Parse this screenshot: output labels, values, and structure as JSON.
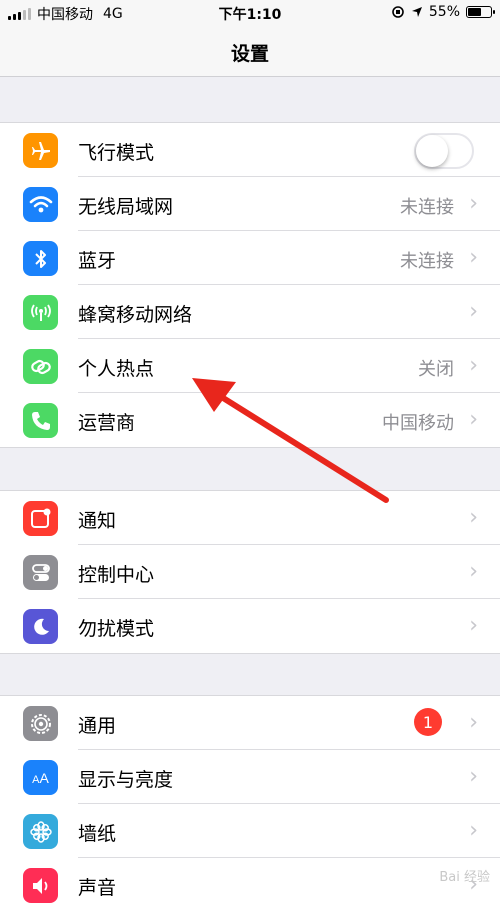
{
  "status_bar": {
    "carrier": "中国移动",
    "network": "4G",
    "time": "下午1:10",
    "battery": "55%"
  },
  "nav": {
    "title": "设置"
  },
  "group1": [
    {
      "label": "飞行模式",
      "color": "#ff9500",
      "icon": "airplane-icon",
      "toggle": "off"
    },
    {
      "label": "无线局域网",
      "value": "未连接",
      "color": "#1a82fb",
      "icon": "wifi-icon"
    },
    {
      "label": "蓝牙",
      "value": "未连接",
      "color": "#1a82fb",
      "icon": "bluetooth-icon"
    },
    {
      "label": "蜂窝移动网络",
      "color": "#4cd964",
      "icon": "cellular-icon"
    },
    {
      "label": "个人热点",
      "value": "关闭",
      "color": "#4cd964",
      "icon": "hotspot-icon"
    },
    {
      "label": "运营商",
      "value": "中国移动",
      "color": "#4cd964",
      "icon": "phone-icon"
    }
  ],
  "group2": [
    {
      "label": "通知",
      "color": "#ff3b30",
      "icon": "notifications-icon"
    },
    {
      "label": "控制中心",
      "color": "#8e8e93",
      "icon": "control-center-icon"
    },
    {
      "label": "勿扰模式",
      "color": "#5856d6",
      "icon": "moon-icon"
    }
  ],
  "group3": [
    {
      "label": "通用",
      "color": "#8e8e93",
      "icon": "gear-icon",
      "badge": "1"
    },
    {
      "label": "显示与亮度",
      "color": "#1a82fb",
      "icon": "display-icon"
    },
    {
      "label": "墙纸",
      "color": "#34aadc",
      "icon": "wallpaper-icon"
    },
    {
      "label": "声音",
      "color": "#ff2d55",
      "icon": "sound-icon"
    }
  ],
  "annotation": {
    "arrow_color": "#e8261c"
  },
  "watermark": "Bai 经验"
}
